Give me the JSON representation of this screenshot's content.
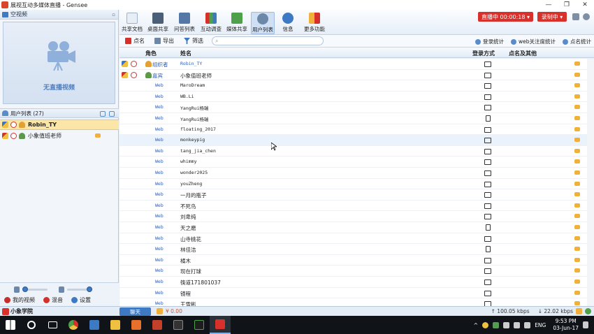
{
  "window": {
    "title": "展视互动多媒体直播 - Gensee",
    "controls": [
      "—",
      "❐",
      "✕"
    ]
  },
  "left": {
    "video_header": "空视频",
    "no_live_text": "无直播视频",
    "userlist_header": "用户列表 (27)",
    "users": [
      {
        "name": "Robin_TY",
        "selected": true
      },
      {
        "name": "小象值班老师",
        "selected": false
      }
    ],
    "my_video": "我的视频",
    "mix": "混音",
    "settings": "设置"
  },
  "toolbar": {
    "buttons": [
      "共享文档",
      "桌面共享",
      "问答列表",
      "互动调查",
      "媒体共享",
      "用户列表",
      "信息",
      "更多功能"
    ],
    "live_label": "直播中 00:00:18 ▾",
    "rec_label": "录制中 ▾"
  },
  "subbar": {
    "rollcall": "点名",
    "export": "导出",
    "filter": "筛选",
    "search_placeholder": "",
    "login_stats": "登录统计",
    "web_focus_stats": "web关注度统计",
    "rollcall_stats": "点名统计"
  },
  "table": {
    "headers": {
      "role": "角色",
      "name": "姓名",
      "login": "登录方式",
      "rollcall": "点名及其他"
    },
    "rows": [
      {
        "role": "组织者",
        "name": "Robin_TY",
        "login": "pc",
        "icons": true,
        "role_style": "big",
        "name_style": "blue"
      },
      {
        "role": "嘉宾",
        "name": "小象值班老师",
        "login": "pc",
        "icons": true,
        "role_style": "big",
        "name_style": "cjk"
      },
      {
        "role": "Web",
        "name": "MaroDream",
        "login": "pc"
      },
      {
        "role": "Web",
        "name": "WB.Li",
        "login": "pc"
      },
      {
        "role": "Web",
        "name": "YangRui杨瑞",
        "login": "pc"
      },
      {
        "role": "Web",
        "name": "YangRui杨瑞",
        "login": "mobile"
      },
      {
        "role": "Web",
        "name": "floating_2017",
        "login": "pc"
      },
      {
        "role": "Web",
        "name": "monkeypig",
        "login": "pc",
        "highlight": true
      },
      {
        "role": "Web",
        "name": "tang_jia_chen",
        "login": "pc"
      },
      {
        "role": "Web",
        "name": "whimmy",
        "login": "pc"
      },
      {
        "role": "Web",
        "name": "wonder2025",
        "login": "pc"
      },
      {
        "role": "Web",
        "name": "youZheng",
        "login": "pc"
      },
      {
        "role": "Web",
        "name": "一月的瓶子",
        "login": "pc",
        "name_style": "cjk"
      },
      {
        "role": "Web",
        "name": "不死鸟",
        "login": "pc",
        "name_style": "cjk"
      },
      {
        "role": "Web",
        "name": "刘卑纯",
        "login": "pc",
        "name_style": "cjk"
      },
      {
        "role": "Web",
        "name": "天之磨",
        "login": "mobile",
        "name_style": "cjk"
      },
      {
        "role": "Web",
        "name": "山寺桃花",
        "login": "pc",
        "name_style": "cjk"
      },
      {
        "role": "Web",
        "name": "林佳洁",
        "login": "mobile",
        "name_style": "cjk"
      },
      {
        "role": "Web",
        "name": "橘木",
        "login": "pc",
        "name_style": "cjk"
      },
      {
        "role": "Web",
        "name": "现在打球",
        "login": "pc",
        "name_style": "cjk"
      },
      {
        "role": "Web",
        "name": "筷道171801037",
        "login": "pc",
        "name_style": "cjk"
      },
      {
        "role": "Web",
        "name": "镜程",
        "login": "pc",
        "name_style": "cjk"
      },
      {
        "role": "Web",
        "name": "王雪彬",
        "login": "pc",
        "name_style": "cjk"
      }
    ]
  },
  "status": {
    "logo_text": "小象学院",
    "chat_tab": "聊天",
    "money": "¥ 0.00",
    "up_speed": "↑ 100.05 kbps",
    "down_speed": "↓ 22.02 kbps"
  },
  "taskbar": {
    "lang": "ENG",
    "time": "9:53 PM",
    "date": "03-Jun-17"
  }
}
